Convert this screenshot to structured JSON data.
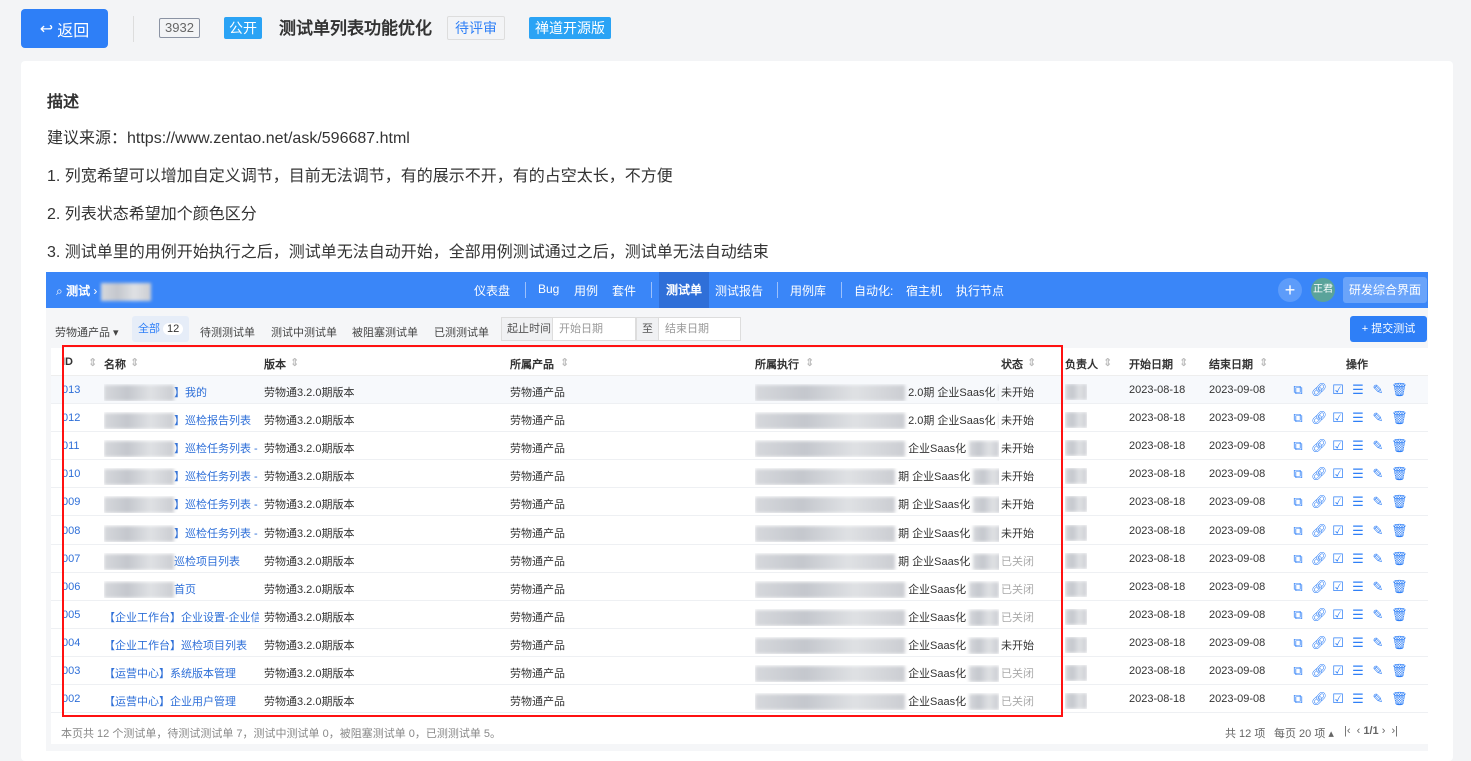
{
  "header": {
    "back_label": "返回",
    "id": "3932",
    "visibility": "公开",
    "title": "测试单列表功能优化",
    "status": "待评审",
    "edition": "禅道开源版"
  },
  "description": {
    "heading": "描述",
    "lines": [
      "建议来源：https://www.zentao.net/ask/596687.html",
      "1. 列宽希望可以增加自定义调节，目前无法调节，有的展示不开，有的占空太长，不方便",
      "2. 列表状态希望加个颜色区分",
      "3. 测试单里的用例开始执行之后，测试单无法自动开始，全部用例测试通过之后，测试单无法自动结束"
    ]
  },
  "app": {
    "breadcrumb": "测试",
    "nav": [
      "仪表盘",
      "Bug",
      "用例",
      "套件",
      "测试单",
      "测试报告",
      "用例库",
      "自动化:",
      "宿主机",
      "执行节点"
    ],
    "user": "正君",
    "switch_label": "研发综合界面",
    "filters": {
      "product": "劳物通产品",
      "all": "全部",
      "all_count": "12",
      "tabs": [
        "待测测试单",
        "测试中测试单",
        "被阻塞测试单",
        "已测测试单"
      ],
      "range_label": "起止时间",
      "start_placeholder": "开始日期",
      "to": "至",
      "end_placeholder": "结束日期"
    },
    "submit_label": "+ 提交测试",
    "columns": [
      "ID",
      "名称",
      "版本",
      "所属产品",
      "所属执行",
      "状态",
      "负责人",
      "开始日期",
      "结束日期",
      "操作"
    ],
    "rows": [
      {
        "id": "013",
        "name": "】我的",
        "version": "劳物通3.2.0期版本",
        "product": "劳物通产品",
        "exec": "2.0期 企业Saas化",
        "status": "未开始",
        "start": "2023-08-18",
        "end": "2023-09-08"
      },
      {
        "id": "012",
        "name": "】巡检报告列表",
        "version": "劳物通3.2.0期版本",
        "product": "劳物通产品",
        "exec": "2.0期 企业Saas化",
        "status": "未开始",
        "start": "2023-08-18",
        "end": "2023-09-08"
      },
      {
        "id": "011",
        "name": "】巡检任务列表 - 创",
        "version": "劳物通3.2.0期版本",
        "product": "劳物通产品",
        "exec": "企业Saas化",
        "status": "未开始",
        "start": "2023-08-18",
        "end": "2023-09-08"
      },
      {
        "id": "010",
        "name": "】巡检任务列表 - 检",
        "version": "劳物通3.2.0期版本",
        "product": "劳物通产品",
        "exec": "期 企业Saas化",
        "status": "未开始",
        "start": "2023-08-18",
        "end": "2023-09-08"
      },
      {
        "id": "009",
        "name": "】巡检任务列表 - 提",
        "version": "劳物通3.2.0期版本",
        "product": "劳物通产品",
        "exec": "期 企业Saas化",
        "status": "未开始",
        "start": "2023-08-18",
        "end": "2023-09-08"
      },
      {
        "id": "008",
        "name": "】巡检任务列表 - 上",
        "version": "劳物通3.2.0期版本",
        "product": "劳物通产品",
        "exec": "期 企业Saas化",
        "status": "未开始",
        "start": "2023-08-18",
        "end": "2023-09-08"
      },
      {
        "id": "007",
        "name": "巡检项目列表",
        "version": "劳物通3.2.0期版本",
        "product": "劳物通产品",
        "exec": "期 企业Saas化",
        "status": "已关闭",
        "start": "2023-08-18",
        "end": "2023-09-08"
      },
      {
        "id": "006",
        "name": "首页",
        "version": "劳物通3.2.0期版本",
        "product": "劳物通产品",
        "exec": "企业Saas化",
        "status": "已关闭",
        "start": "2023-08-18",
        "end": "2023-09-08"
      },
      {
        "id": "005",
        "name": "【企业工作台】企业设置-企业信息",
        "version": "劳物通3.2.0期版本",
        "product": "劳物通产品",
        "exec": "企业Saas化",
        "status": "已关闭",
        "start": "2023-08-18",
        "end": "2023-09-08"
      },
      {
        "id": "004",
        "name": "【企业工作台】巡检项目列表",
        "version": "劳物通3.2.0期版本",
        "product": "劳物通产品",
        "exec": "企业Saas化",
        "status": "未开始",
        "start": "2023-08-18",
        "end": "2023-09-08"
      },
      {
        "id": "003",
        "name": "【运营中心】系统版本管理",
        "version": "劳物通3.2.0期版本",
        "product": "劳物通产品",
        "exec": "企业Saas化",
        "status": "已关闭",
        "start": "2023-08-18",
        "end": "2023-09-08"
      },
      {
        "id": "002",
        "name": "【运营中心】企业用户管理",
        "version": "劳物通3.2.0期版本",
        "product": "劳物通产品",
        "exec": "企业Saas化",
        "status": "已关闭",
        "start": "2023-08-18",
        "end": "2023-09-08"
      }
    ],
    "summary": "本页共 12 个测试单，待测试测试单 7，测试中测试单 0，被阻塞测试单 0，已测测试单 5。",
    "pager": {
      "total": "共 12 项",
      "per_page": "每页 20 项",
      "page": "1/1"
    }
  },
  "colors": {
    "primary": "#2e7ff7",
    "nav": "#3a86f8",
    "highlight": "#ff1111"
  }
}
